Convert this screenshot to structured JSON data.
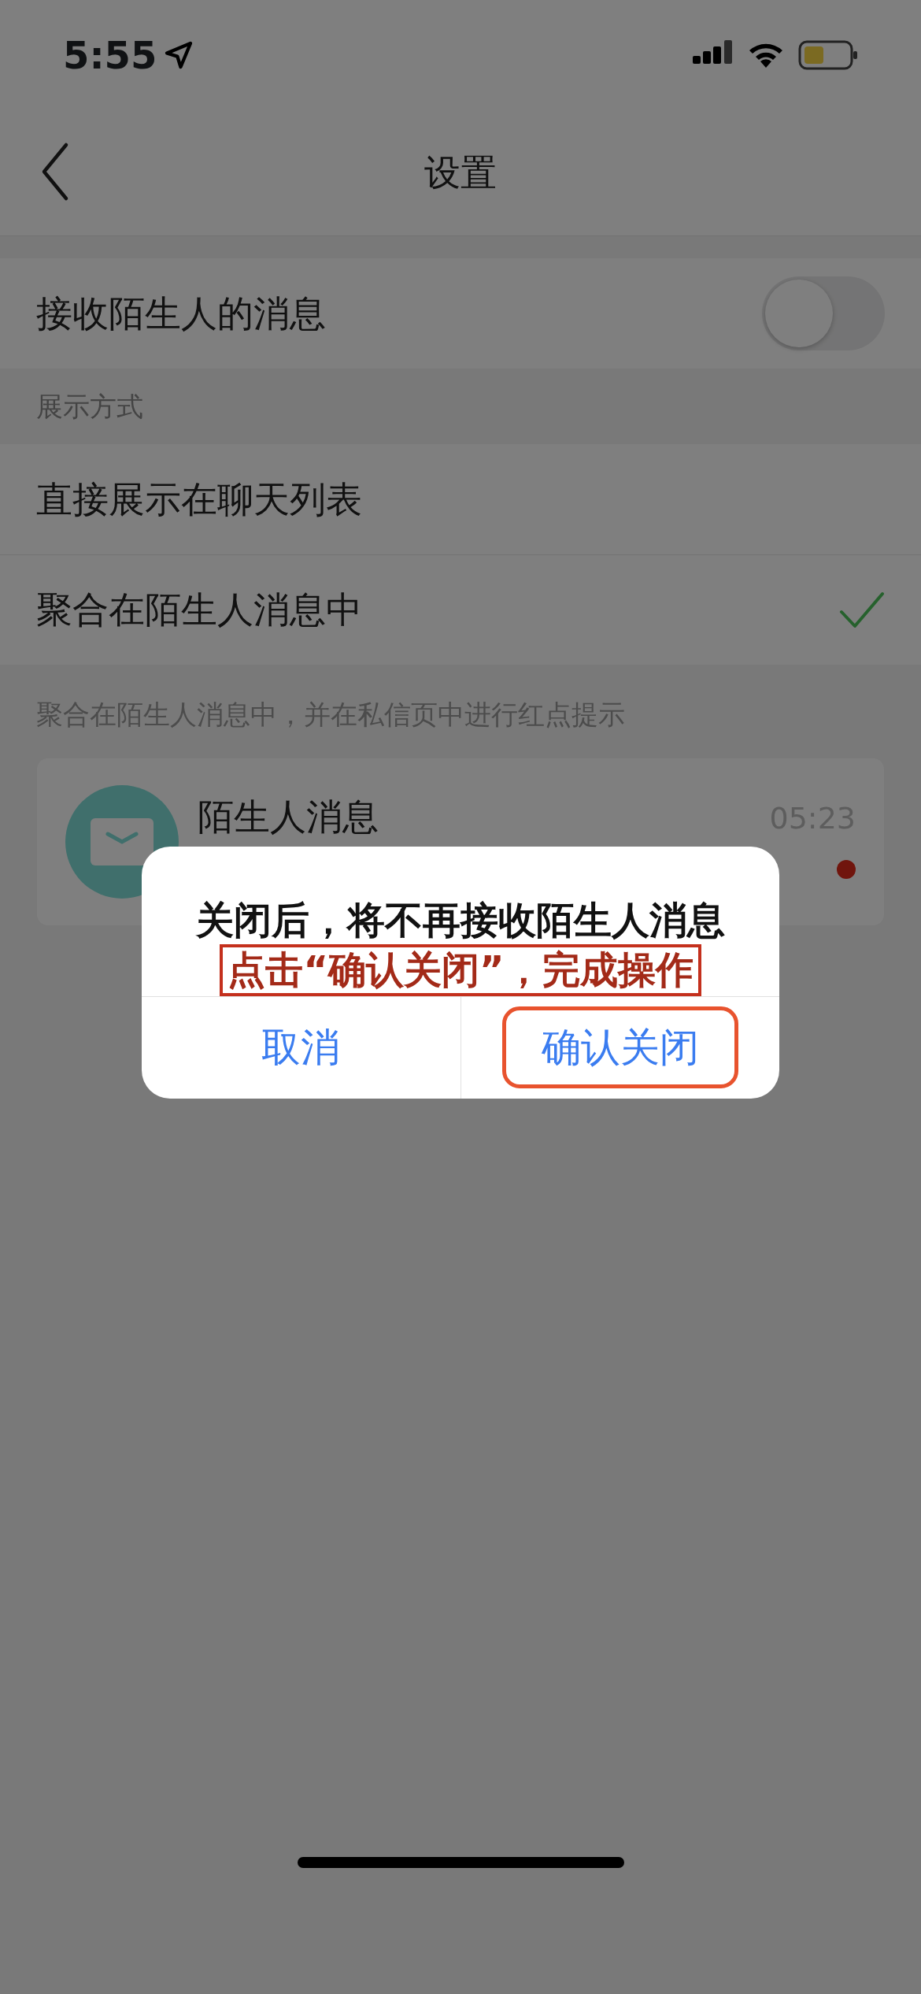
{
  "status_bar": {
    "time": "5:55"
  },
  "nav": {
    "title": "设置"
  },
  "stranger_toggle": {
    "label": "接收陌生人的消息",
    "on": false
  },
  "section_header": "展示方式",
  "display_options": [
    {
      "label": "直接展示在聊天列表",
      "selected": false
    },
    {
      "label": "聚合在陌生人消息中",
      "selected": true
    }
  ],
  "note": "聚合在陌生人消息中，并在私信页中进行红点提示",
  "message_card": {
    "title": "陌生人消息",
    "time": "05:23",
    "unread": true
  },
  "dialog": {
    "message": "关闭后，将不再接收陌生人消息",
    "hint": "点击“确认关闭”，完成操作",
    "buttons": [
      {
        "label": "取消",
        "highlighted": false
      },
      {
        "label": "确认关闭",
        "highlighted": true
      }
    ]
  }
}
